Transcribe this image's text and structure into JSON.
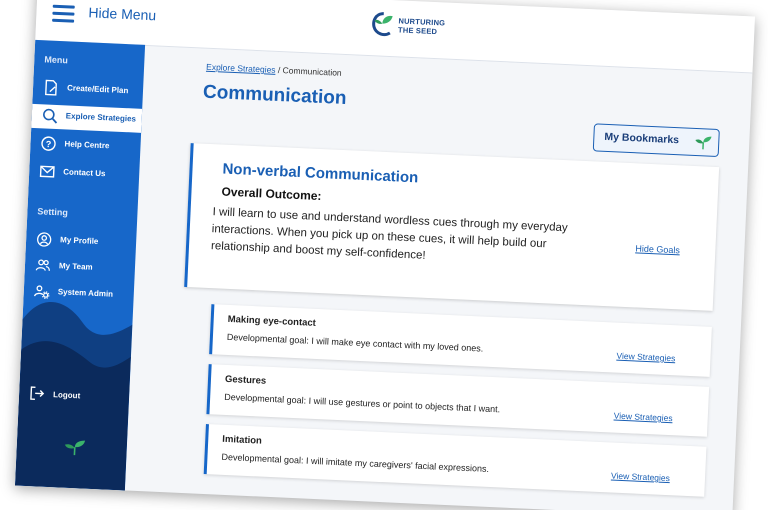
{
  "topbar": {
    "hide_menu_label": "Hide Menu",
    "logo_line1": "NURTURING",
    "logo_line2": "THE SEED"
  },
  "sidebar": {
    "menu_heading": "Menu",
    "items": [
      {
        "label": "Create/Edit Plan",
        "icon": "document-edit-icon"
      },
      {
        "label": "Explore Strategies",
        "icon": "search-icon"
      },
      {
        "label": "Help Centre",
        "icon": "help-icon"
      },
      {
        "label": "Contact Us",
        "icon": "mail-icon"
      }
    ],
    "setting_heading": "Setting",
    "settings": [
      {
        "label": "My Profile",
        "icon": "user-circle-icon"
      },
      {
        "label": "My Team",
        "icon": "team-icon"
      },
      {
        "label": "System Admin",
        "icon": "admin-icon"
      }
    ],
    "logout_label": "Logout"
  },
  "main": {
    "breadcrumb": {
      "link": "Explore Strategies",
      "separator": "/",
      "current": "Communication"
    },
    "title": "Communication",
    "bookmarks_label": "My Bookmarks",
    "goal_card": {
      "title": "Non-verbal Communication",
      "subtitle": "Overall Outcome:",
      "text": "I will learn to use and understand wordless cues through my everyday interactions. When you pick up on these cues, it will help build our relationship and boost my self-confidence!",
      "hide_goals_label": "Hide Goals"
    },
    "dev_goals": [
      {
        "title": "Making eye-contact",
        "desc": "Developmental goal: I will make eye contact with my loved ones.",
        "link": "View Strategies"
      },
      {
        "title": "Gestures",
        "desc": "Developmental goal: I will use gestures or point to objects that I want.",
        "link": "View Strategies"
      },
      {
        "title": "Imitation",
        "desc": "Developmental goal: I will imitate my caregivers' facial expressions.",
        "link": "View Strategies"
      }
    ]
  },
  "colors": {
    "primary": "#1767c9",
    "sidebar_dark": "#0b2a5c",
    "leaf_green": "#3bb36b"
  }
}
